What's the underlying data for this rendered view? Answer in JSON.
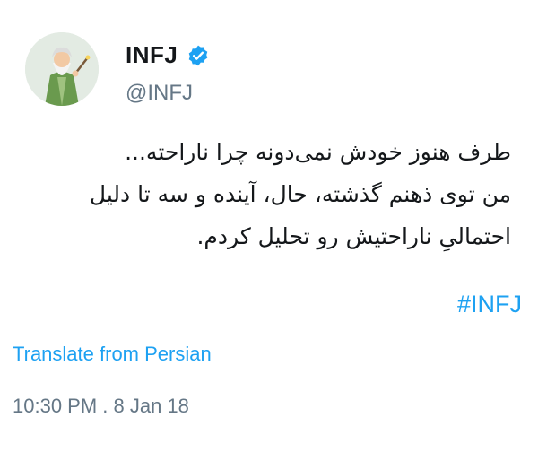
{
  "user": {
    "name": "INFJ",
    "handle": "@INFJ",
    "verified": true,
    "avatar_icon": "wizard-avatar-icon"
  },
  "tweet": {
    "lines": [
      "طرف هنوز خودش نمی‌دونه چرا ناراحته...",
      "من توی ذهنم گذشته، حال، آینده و سه تا دلیل",
      "احتمالیِ ناراحتیش رو تحلیل کردم."
    ],
    "hashtag": "#INFJ"
  },
  "translate_label": "Translate from Persian",
  "timestamp": "10:30 PM . 8 Jan 18",
  "colors": {
    "link": "#1da1f2",
    "secondary_text": "#657786",
    "primary_text": "#14171a",
    "verified_badge": "#1da1f2"
  }
}
